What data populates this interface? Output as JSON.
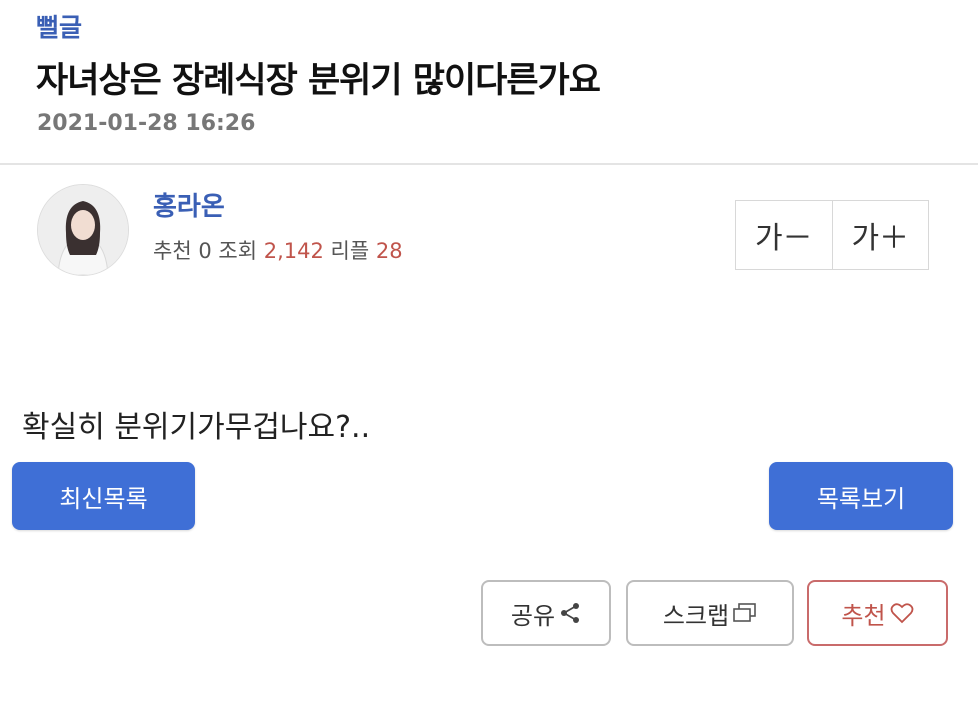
{
  "post": {
    "category": "뻘글",
    "title": "자녀상은 장례식장 분위기 많이다른가요",
    "datetime": "2021-01-28 16:26"
  },
  "author": {
    "name": "홍라온",
    "stats": {
      "recommend_label": "추천",
      "recommend_count": "0",
      "views_label": "조회",
      "views_count": "2,142",
      "replies_label": "리플",
      "replies_count": "28"
    }
  },
  "font_controls": {
    "decrease_label": "가－",
    "increase_label": "가＋"
  },
  "content": {
    "body": "확실히 분위기가무겁나요?.."
  },
  "nav": {
    "latest_label": "최신목록",
    "list_label": "목록보기"
  },
  "actions": {
    "share_label": "공유",
    "scrap_label": "스크랩",
    "recommend_label": "추천"
  },
  "colors": {
    "accent_blue": "#3f6fd6",
    "link_blue": "#3a5fb5",
    "count_red": "#c0544b"
  },
  "icons": {
    "share": "share-icon",
    "scrap": "scrap-icon",
    "recommend": "heart-icon"
  }
}
